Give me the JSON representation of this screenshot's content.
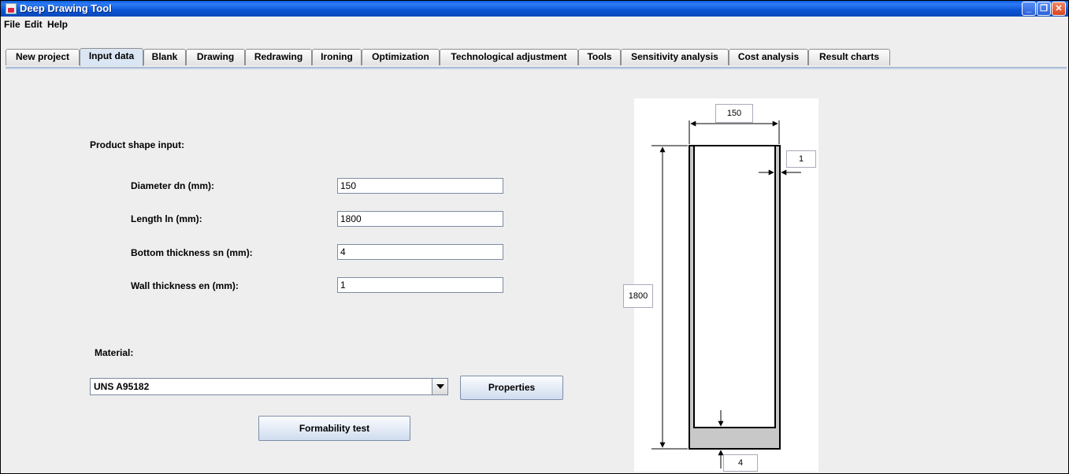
{
  "window": {
    "title": "Deep Drawing Tool"
  },
  "menu": [
    "File",
    "Edit",
    "Help"
  ],
  "tabs": [
    "New project",
    "Input data",
    "Blank",
    "Drawing",
    "Redrawing",
    "Ironing",
    "Optimization",
    "Technological adjustment",
    "Tools",
    "Sensitivity analysis",
    "Cost analysis",
    "Result charts"
  ],
  "active_tab": "Input data",
  "form": {
    "section_title": "Product shape input:",
    "diameter_label": "Diameter dn (mm):",
    "diameter_value": "150",
    "length_label": "Length ln (mm):",
    "length_value": "1800",
    "bottom_label": "Bottom thickness sn (mm):",
    "bottom_value": "4",
    "wall_label": "Wall thickness en (mm):",
    "wall_value": "1"
  },
  "material": {
    "label": "Material:",
    "selected": "UNS A95182",
    "properties_button": "Properties",
    "formability_button": "Formability test"
  },
  "drawing": {
    "diameter": "150",
    "length": "1800",
    "wall": "1",
    "bottom": "4"
  }
}
